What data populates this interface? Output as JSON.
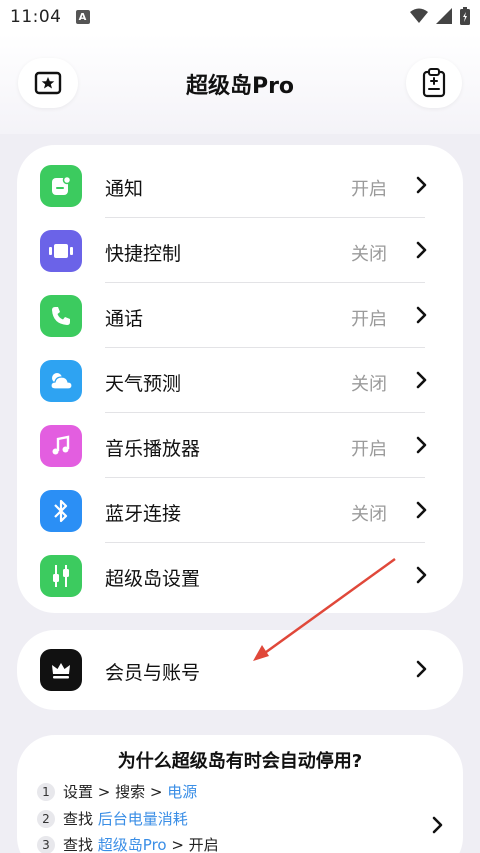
{
  "status": {
    "time": "11:04",
    "notif_letter": "A"
  },
  "header": {
    "title": "超级岛Pro"
  },
  "settings": [
    {
      "label": "通知",
      "status": "开启",
      "color": "#3ccb5f",
      "icon": "notification-icon"
    },
    {
      "label": "快捷控制",
      "status": "关闭",
      "color": "#6b63e8",
      "icon": "quick-control-icon"
    },
    {
      "label": "通话",
      "status": "开启",
      "color": "#3ccb5f",
      "icon": "phone-icon"
    },
    {
      "label": "天气预测",
      "status": "关闭",
      "color": "#2ea3f2",
      "icon": "weather-icon"
    },
    {
      "label": "音乐播放器",
      "status": "开启",
      "color": "#e35ee0",
      "icon": "music-icon"
    },
    {
      "label": "蓝牙连接",
      "status": "关闭",
      "color": "#2b8ff5",
      "icon": "bluetooth-icon"
    },
    {
      "label": "超级岛设置",
      "status": "",
      "color": "#3ccb5f",
      "icon": "island-settings-icon"
    }
  ],
  "member": {
    "label": "会员与账号",
    "color": "#111111",
    "icon": "crown-icon"
  },
  "help": {
    "title": "为什么超级岛有时会自动停用?",
    "steps": [
      {
        "num": "1",
        "prefix": "设置 > 搜索 > ",
        "link": "电源",
        "suffix": ""
      },
      {
        "num": "2",
        "prefix": "查找 ",
        "link": "后台电量消耗",
        "suffix": ""
      },
      {
        "num": "3",
        "prefix": "查找 ",
        "link": "超级岛Pro",
        "suffix": " > 开启"
      }
    ]
  }
}
